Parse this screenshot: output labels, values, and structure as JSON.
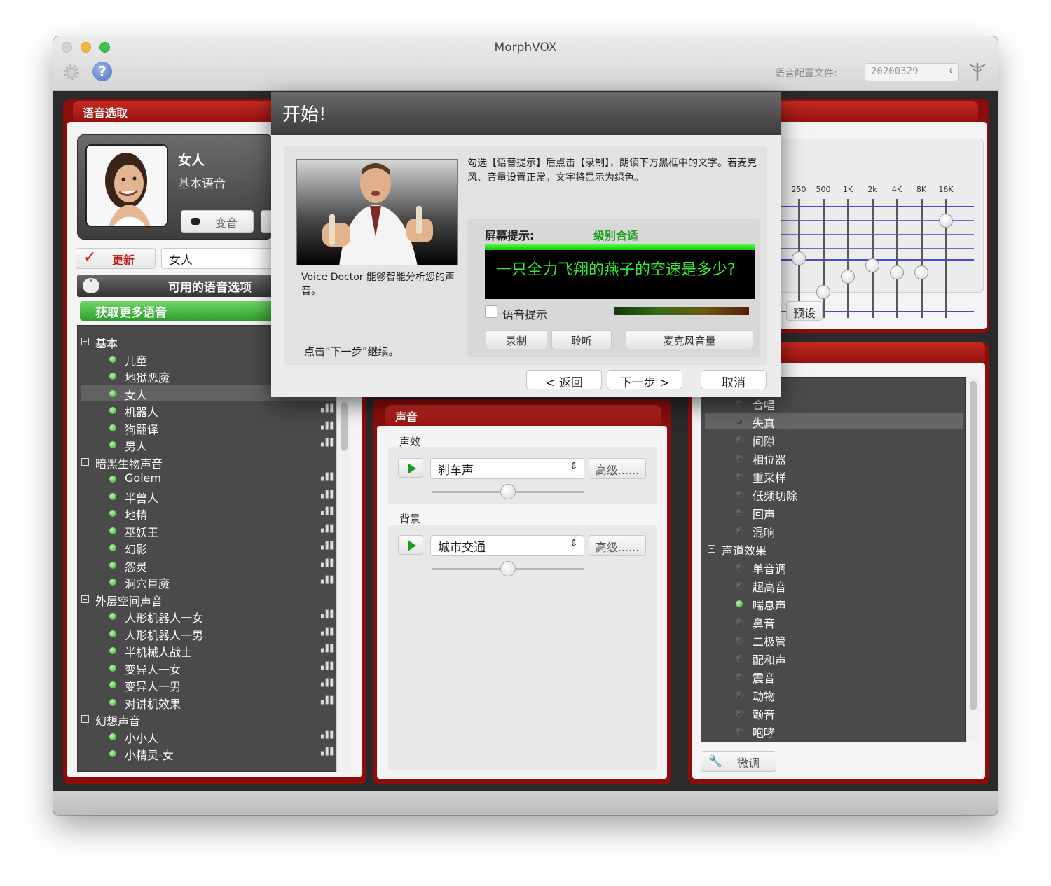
{
  "window": {
    "title": "MorphVOX"
  },
  "toolbar": {
    "profile_label": "语音配置文件:",
    "profile_value": "20200329"
  },
  "voice_panel": {
    "title": "语音选取",
    "current_voice": "女人",
    "current_type": "基本语音",
    "morph_button": "变音",
    "update_button": "更新",
    "voice_field": "女人",
    "available_header": "可用的语音选项",
    "get_more": "获取更多语音",
    "groups": [
      {
        "name": "基本",
        "items": [
          "儿童",
          "地狱恶魔",
          "女人",
          "机器人",
          "狗翻译",
          "男人"
        ]
      },
      {
        "name": "暗黑生物声音",
        "items": [
          "Golem",
          "半兽人",
          "地精",
          "巫妖王",
          "幻影",
          "怨灵",
          "洞穴巨魔"
        ]
      },
      {
        "name": "外层空间声音",
        "items": [
          "人形机器人一女",
          "人形机器人一男",
          "半机械人战士",
          "变异人一女",
          "变异人一男",
          "对讲机效果"
        ]
      },
      {
        "name": "幻想声音",
        "items": [
          "小小人",
          "小精灵-女"
        ]
      }
    ]
  },
  "sound_panel": {
    "title": "声音",
    "effects_label": "声效",
    "effect_value": "刹车声",
    "advanced_label": "高级......",
    "effect_volume": 0.5,
    "background_label": "背景",
    "background_value": "城市交通",
    "background_volume": 0.5
  },
  "eq_panel": {
    "bands": [
      "250",
      "500",
      "1K",
      "2k",
      "4K",
      "8K",
      "16K"
    ],
    "levels": [
      0.5,
      0.22,
      0.35,
      0.44,
      0.38,
      0.38,
      0.82
    ],
    "preset_button": "预设"
  },
  "effects_panel": {
    "items_top": [
      "合唱",
      "失真",
      "间隙",
      "相位器",
      "重采样",
      "低频切除",
      "回声",
      "混响"
    ],
    "group_name": "声道效果",
    "items_group": [
      "单音调",
      "超高音",
      "喘息声",
      "鼻音",
      "二极管",
      "配和声",
      "震音",
      "动物",
      "颤音",
      "咆哮"
    ],
    "tweak_button": "微调"
  },
  "dialog": {
    "title": "开始!",
    "instructions": "勾选【语音提示】后点击【录制】，朗读下方黑框中的文字。若麦克风、音量设置正常，文字将显示为绿色。",
    "caption": "Voice Doctor 能够智能分析您的声音。",
    "continue_hint": "点击“下一步”继续。",
    "screen_prompt_label": "屏幕提示:",
    "level_status": "级别合适",
    "prompt_text": "一只全力飞翔的燕子的空速是多少?",
    "voice_hint_label": "语音提示",
    "record_button": "录制",
    "listen_button": "聆听",
    "mic_volume_button": "麦克风音量",
    "back_button": "< 返回",
    "next_button": "下一步 >",
    "cancel_button": "取消"
  },
  "colors": {
    "panel_red": "#8d0d0d",
    "accent_green": "#2fbf2f",
    "dark_bg": "#4a4a4a"
  }
}
